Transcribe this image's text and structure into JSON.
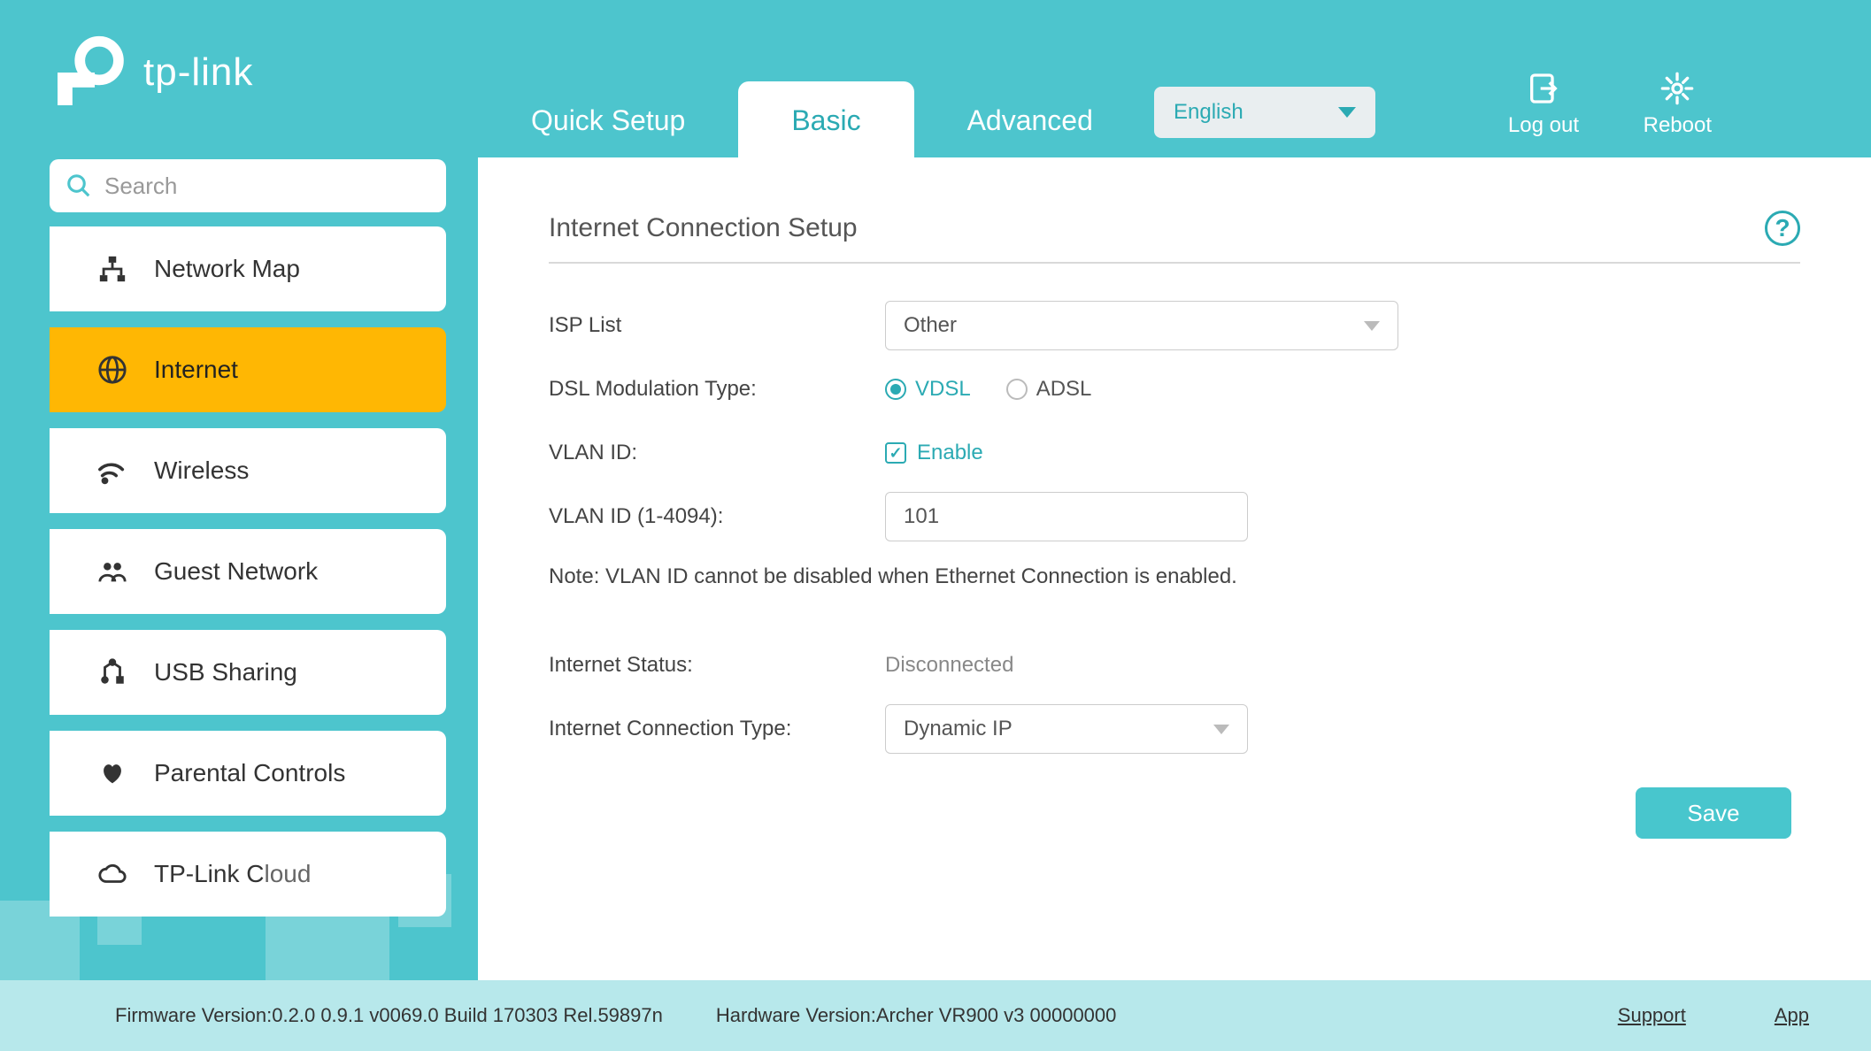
{
  "brand": "tp-link",
  "tabs": {
    "quick_setup": "Quick Setup",
    "basic": "Basic",
    "advanced": "Advanced",
    "active": "basic"
  },
  "language": "English",
  "header_actions": {
    "logout": "Log out",
    "reboot": "Reboot"
  },
  "search": {
    "placeholder": "Search"
  },
  "sidebar": {
    "items": [
      {
        "id": "network-map",
        "label": "Network Map"
      },
      {
        "id": "internet",
        "label": "Internet"
      },
      {
        "id": "wireless",
        "label": "Wireless"
      },
      {
        "id": "guest-network",
        "label": "Guest Network"
      },
      {
        "id": "usb-sharing",
        "label": "USB Sharing"
      },
      {
        "id": "parental-controls",
        "label": "Parental Controls"
      },
      {
        "id": "tplink-cloud",
        "label": "TP-Link Cloud"
      }
    ],
    "active": "internet"
  },
  "panel": {
    "title": "Internet Connection Setup",
    "labels": {
      "isp_list": "ISP List",
      "dsl_mod": "DSL Modulation Type:",
      "vlan_id": "VLAN ID:",
      "vlan_id_range": "VLAN ID (1-4094):",
      "internet_status": "Internet Status:",
      "conn_type": "Internet Connection Type:"
    },
    "isp_value": "Other",
    "dsl_options": {
      "vdsl": "VDSL",
      "adsl": "ADSL"
    },
    "dsl_selected": "vdsl",
    "vlan_enable_label": "Enable",
    "vlan_enabled": true,
    "vlan_id_value": "101",
    "note": "Note: VLAN ID cannot be disabled when Ethernet Connection is enabled.",
    "internet_status": "Disconnected",
    "conn_type_value": "Dynamic IP",
    "save_label": "Save"
  },
  "footer": {
    "firmware_label": "Firmware Version:",
    "firmware": "0.2.0 0.9.1 v0069.0 Build 170303 Rel.59897n",
    "hardware_label": "Hardware Version:",
    "hardware": "Archer VR900 v3 00000000",
    "support": "Support",
    "app": "App"
  }
}
